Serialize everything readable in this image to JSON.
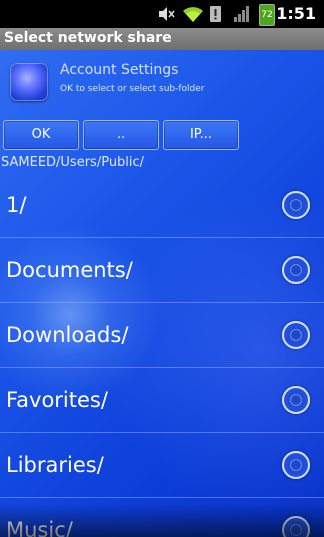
{
  "status_bar": {
    "time": "1:51",
    "battery_level": "72",
    "icons": [
      "mute-icon",
      "wifi-icon",
      "alert-icon",
      "signal-icon",
      "battery-icon"
    ]
  },
  "title_bar": {
    "title": "Select network share"
  },
  "header": {
    "title": "Account Settings",
    "subtitle": "OK to select or select sub-folder"
  },
  "buttons": {
    "ok": "OK",
    "up": "..",
    "ip": "IP..."
  },
  "current_path": "SAMEED/Users/Public/",
  "list": {
    "items": [
      {
        "label": "1/"
      },
      {
        "label": "Documents/"
      },
      {
        "label": "Downloads/"
      },
      {
        "label": "Favorites/"
      },
      {
        "label": "Libraries/"
      },
      {
        "label": "Music/"
      }
    ]
  },
  "colors": {
    "background": "#0b3fd6",
    "title_bar": "#7a7a7a",
    "status_bar": "#000000",
    "button": "#2d63ee",
    "text": "#ffffff"
  }
}
